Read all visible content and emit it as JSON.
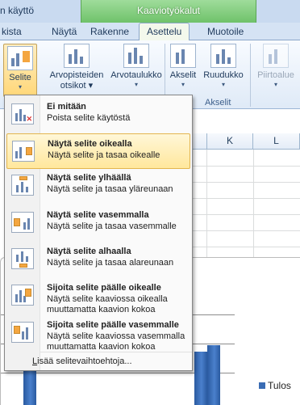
{
  "title_fragment": "n käyttö",
  "context_header": "Kaaviotyökalut",
  "tabs": [
    "kista",
    "Näytä",
    "Rakenne",
    "Asettelu",
    "Muotoile"
  ],
  "ribbon": {
    "legend_btn": "Selite",
    "datalabels_btn_l1": "Arvopisteiden",
    "datalabels_btn_l2": "otsikot",
    "datatable_btn": "Arvotaulukko",
    "axes_btn": "Akselit",
    "gridlines_btn": "Ruudukko",
    "plotarea_btn": "Piirtoalue",
    "axes_group": "Akselit"
  },
  "columns": [
    "K",
    "L"
  ],
  "menu": {
    "items": [
      {
        "title": "Ei mitään",
        "desc": "Poista selite käytöstä"
      },
      {
        "title": "Näytä selite oikealla",
        "desc": "Näytä selite ja tasaa oikealle"
      },
      {
        "title": "Näytä selite ylhäällä",
        "desc": "Näytä selite ja tasaa yläreunaan"
      },
      {
        "title": "Näytä selite vasemmalla",
        "desc": "Näytä selite ja tasaa vasemmalle"
      },
      {
        "title": "Näytä selite alhaalla",
        "desc": "Näytä selite ja tasaa alareunaan"
      },
      {
        "title": "Sijoita selite päälle oikealle",
        "desc": "Näytä selite kaaviossa oikealla muuttamatta kaavion kokoa"
      },
      {
        "title": "Sijoita selite päälle vasemmalle",
        "desc": "Näytä selite kaaviossa vasemmalla muuttamatta kaavion kokoa"
      }
    ],
    "more_prefix": "L",
    "more_rest": "isää selitevaihtoehtoja..."
  },
  "chart_legend": "Tulos",
  "colors": {
    "context_green": "#6fc26a",
    "highlight": "#ffe79c",
    "accent_orange": "#f4a640",
    "bar_blue": "#3a6cb4"
  }
}
